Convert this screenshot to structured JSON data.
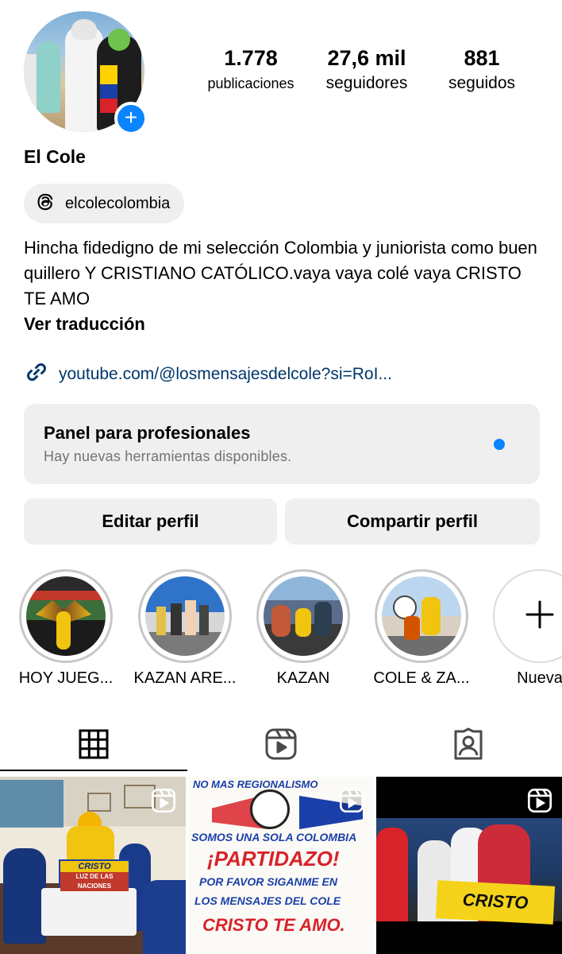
{
  "profile": {
    "name": "El Cole",
    "threads_handle": "elcolecolombia",
    "bio": "Hincha fidedigno de mi selección Colombia y juniorista como buen quillero Y CRISTIANO CATÓLICO.vaya vaya colé vaya CRISTO TE AMO",
    "translate_label": "Ver traducción",
    "link": "youtube.com/@losmensajesdelcole?si=RoI..."
  },
  "stats": [
    {
      "value": "1.778",
      "label": "publicaciones"
    },
    {
      "value": "27,6 mil",
      "label": "seguidores"
    },
    {
      "value": "881",
      "label": "seguidos"
    }
  ],
  "panel": {
    "title": "Panel para profesionales",
    "subtitle": "Hay nuevas herramientas disponibles."
  },
  "buttons": {
    "edit": "Editar perfil",
    "share": "Compartir perfil"
  },
  "highlights": [
    {
      "label": "HOY JUEG..."
    },
    {
      "label": "KAZAN ARE..."
    },
    {
      "label": "KAZAN"
    },
    {
      "label": "COLE & ZA..."
    },
    {
      "label": "Nueva"
    }
  ],
  "posts": [
    {
      "banner_text": "CRISTO",
      "banner_sub": "LUZ DE LAS NACIONES"
    },
    {
      "top_text": "NO MAS REGIONALISMO",
      "line1": "SOMOS UNA SOLA COLOMBIA",
      "line2": "¡PARTIDAZO!",
      "line3": "POR FAVOR SIGANME EN",
      "line4": "LOS MENSAJES DEL COLE",
      "line5": "CRISTO TE AMO."
    },
    {
      "banner_text": "CRISTO"
    }
  ],
  "colors": {
    "accent_blue": "#0a84ff",
    "link": "#00376b",
    "pill_bg": "#efefef",
    "muted": "#737373"
  }
}
